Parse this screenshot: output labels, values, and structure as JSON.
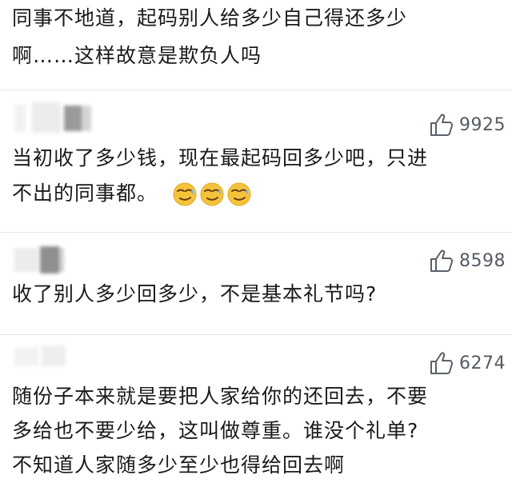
{
  "comments": [
    {
      "lines": [
        "同事不地道，起码别人给多少自己得还多少",
        "啊……这样故意是欺负人吗"
      ]
    },
    {
      "likes": "9925",
      "lines": [
        "当初收了多少钱，现在最起码回多少吧，只进",
        "不出的同事都。"
      ],
      "emoji": "smirk-emoji"
    },
    {
      "likes": "8598",
      "lines": [
        "收了别人多少回多少，不是基本礼节吗?"
      ]
    },
    {
      "likes": "6274",
      "lines": [
        "随份子本来就是要把人家给你的还回去，不要",
        "多给也不要少给，这叫做尊重。谁没个礼单?",
        "不知道人家随多少至少也得给回去啊"
      ]
    }
  ],
  "icons": {
    "like": "thumbs-up-icon",
    "emoji": "smirk-emoji"
  },
  "colors": {
    "text": "#1a1a1a",
    "like_count": "#555b63",
    "separator": "#e6e6e6",
    "emoji_face": "#f5c33b"
  }
}
